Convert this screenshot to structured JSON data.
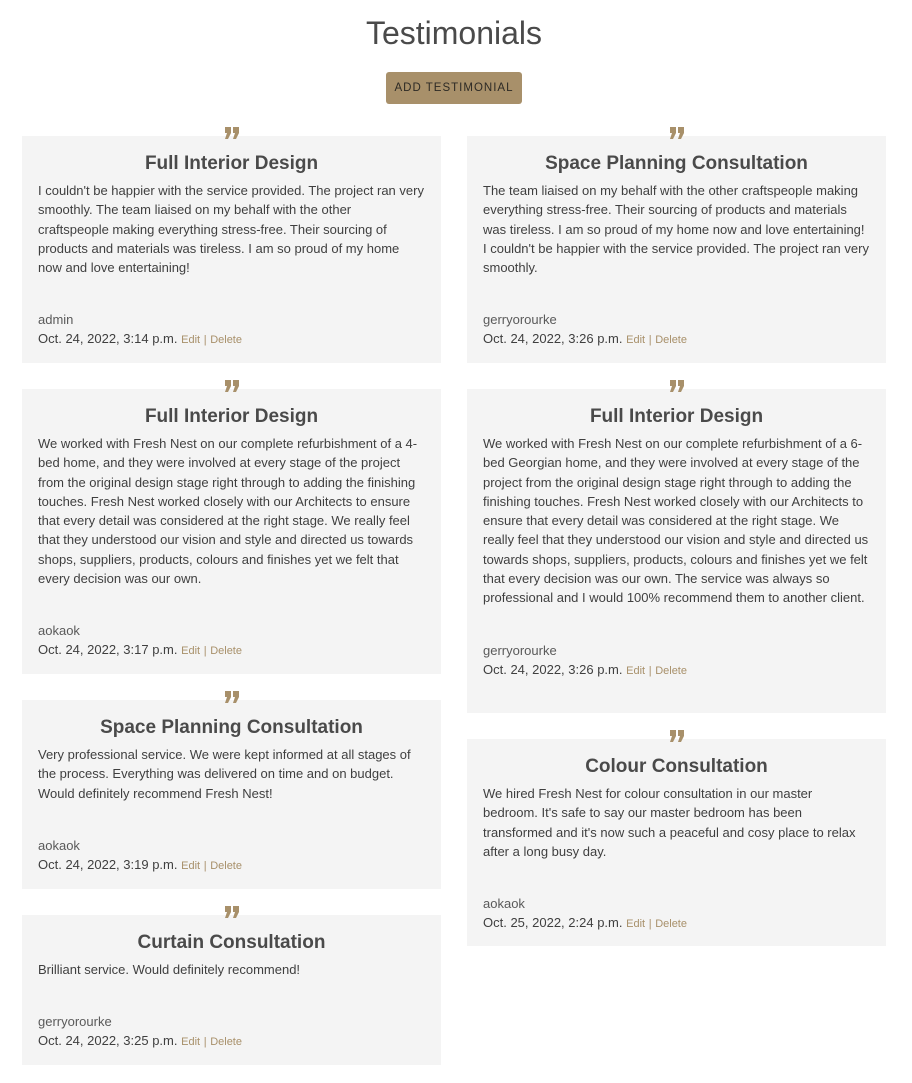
{
  "page": {
    "title": "Testimonials",
    "add_button_label": "ADD TESTIMONIAL",
    "edit_label": "Edit",
    "delete_label": "Delete",
    "separator": "|"
  },
  "colors": {
    "accent": "#a8906a",
    "card_background": "#f4f4f4",
    "title_text": "#4a4a4a"
  },
  "testimonials": [
    {
      "title": "Full Interior Design",
      "body": "I couldn't be happier with the service provided. The project ran very smoothly. The team liaised on my behalf with the other craftspeople making everything stress-free. Their sourcing of products and materials was tireless. I am so proud of my home now and love entertaining!",
      "author": "admin",
      "date": "Oct. 24, 2022, 3:14 p.m."
    },
    {
      "title": "Space Planning Consultation",
      "body": "The team liaised on my behalf with the other craftspeople making everything stress-free. Their sourcing of products and materials was tireless. I am so proud of my home now and love entertaining! I couldn't be happier with the service provided. The project ran very smoothly.",
      "author": "gerryorourke",
      "date": "Oct. 24, 2022, 3:26 p.m."
    },
    {
      "title": "Full Interior Design",
      "body": "We worked with Fresh Nest on our complete refurbishment of a 4-bed home, and they were involved at every stage of the project from the original design stage right through to adding the finishing touches. Fresh Nest worked closely with our Architects to ensure that every detail was considered at the right stage. We really feel that they understood our vision and style and directed us towards shops, suppliers, products, colours and finishes yet we felt that every decision was our own.",
      "author": "aokaok",
      "date": "Oct. 24, 2022, 3:17 p.m."
    },
    {
      "title": "Full Interior Design",
      "body": "We worked with Fresh Nest on our complete refurbishment of a 6-bed Georgian home, and they were involved at every stage of the project from the original design stage right through to adding the finishing touches. Fresh Nest worked closely with our Architects to ensure that every detail was considered at the right stage. We really feel that they understood our vision and style and directed us towards shops, suppliers, products, colours and finishes yet we felt that every decision was our own. The service was always so professional and I would 100% recommend them to another client.",
      "author": "gerryorourke",
      "date": "Oct. 24, 2022, 3:26 p.m."
    },
    {
      "title": "Space Planning Consultation",
      "body": "Very professional service. We were kept informed at all stages of the process. Everything was delivered on time and on budget. Would definitely recommend Fresh Nest!",
      "author": "aokaok",
      "date": "Oct. 24, 2022, 3:19 p.m."
    },
    {
      "title": "Colour Consultation",
      "body": "We hired Fresh Nest for colour consultation in our master bedroom. It's safe to say our master bedroom has been transformed and it's now such a peaceful and cosy place to relax after a long busy day.",
      "author": "aokaok",
      "date": "Oct. 25, 2022, 2:24 p.m."
    },
    {
      "title": "Curtain Consultation",
      "body": "Brilliant service. Would definitely recommend!",
      "author": "gerryorourke",
      "date": "Oct. 24, 2022, 3:25 p.m."
    }
  ]
}
